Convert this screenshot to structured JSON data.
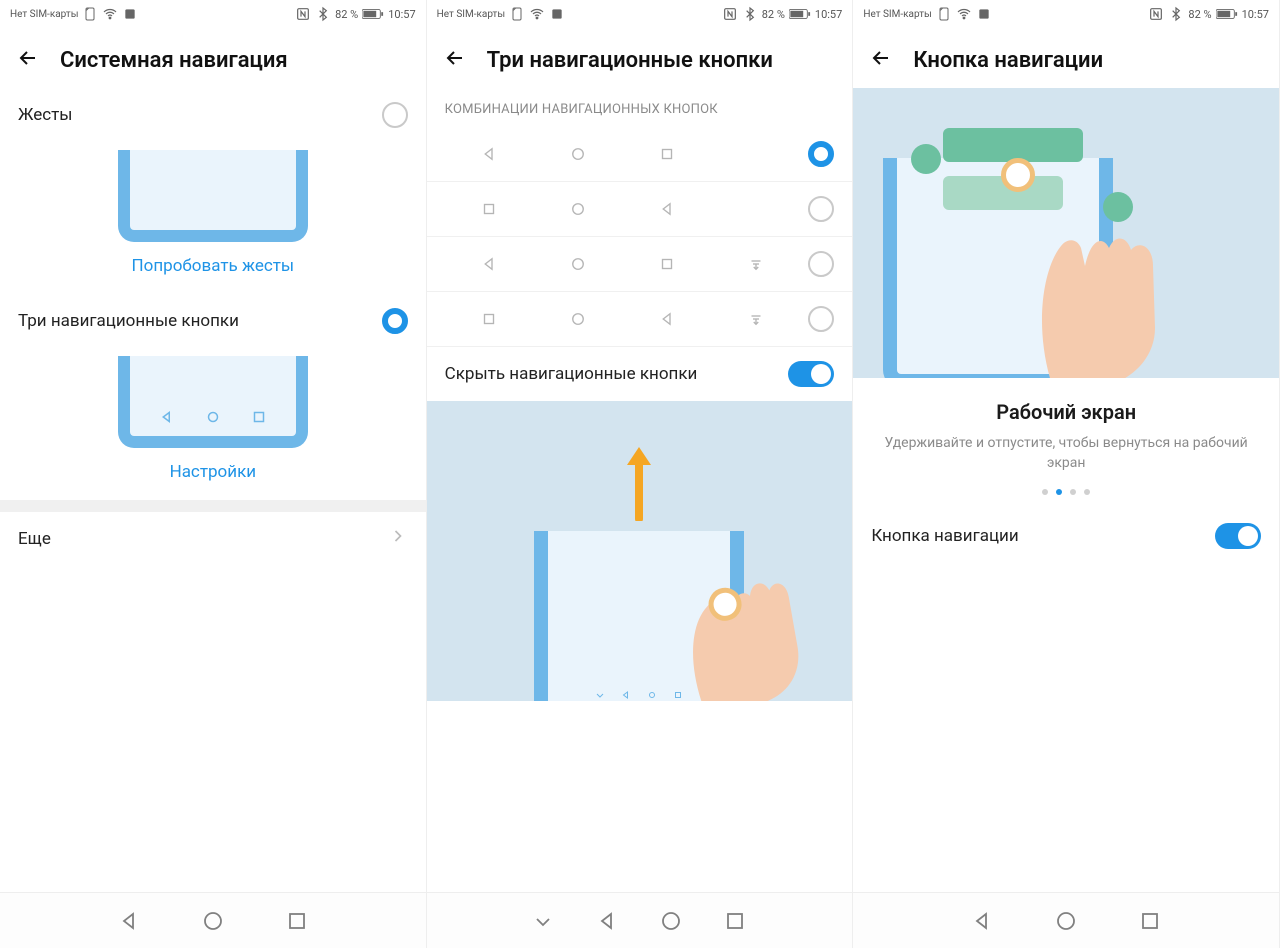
{
  "status": {
    "sim_text": "Нет SIM-карты",
    "battery_pct": "82 %",
    "time": "10:57"
  },
  "screen1": {
    "title": "Системная навигация",
    "opt_gestures": "Жесты",
    "try_gestures": "Попробовать жесты",
    "opt_three_keys": "Три навигационные кнопки",
    "settings": "Настройки",
    "more": "Еще"
  },
  "screen2": {
    "title": "Три навигационные кнопки",
    "section": "КОМБИНАЦИИ НАВИГАЦИОННЫХ КНОПОК",
    "hide_nav": "Скрыть навигационные кнопки",
    "combos": [
      {
        "icons": [
          "back",
          "home",
          "recent"
        ],
        "selected": true
      },
      {
        "icons": [
          "recent",
          "home",
          "back"
        ],
        "selected": false
      },
      {
        "icons": [
          "back",
          "home",
          "recent",
          "notif"
        ],
        "selected": false
      },
      {
        "icons": [
          "recent",
          "home",
          "back",
          "notif"
        ],
        "selected": false
      }
    ]
  },
  "screen3": {
    "title": "Кнопка навигации",
    "card_title": "Рабочий экран",
    "card_desc": "Удерживайте и отпустите, чтобы вернуться на рабочий экран",
    "toggle_label": "Кнопка навигации",
    "active_dot": 1,
    "dot_count": 4
  }
}
